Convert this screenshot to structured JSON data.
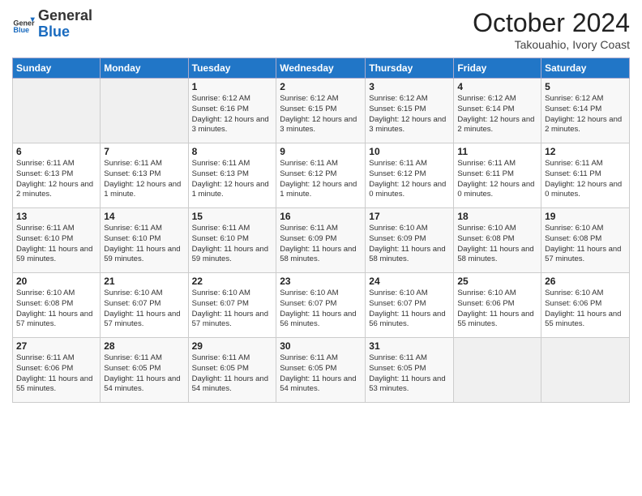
{
  "header": {
    "logo_general": "General",
    "logo_blue": "Blue",
    "month_title": "October 2024",
    "subtitle": "Takouahio, Ivory Coast"
  },
  "days_of_week": [
    "Sunday",
    "Monday",
    "Tuesday",
    "Wednesday",
    "Thursday",
    "Friday",
    "Saturday"
  ],
  "weeks": [
    [
      {
        "day": "",
        "info": ""
      },
      {
        "day": "",
        "info": ""
      },
      {
        "day": "1",
        "info": "Sunrise: 6:12 AM\nSunset: 6:16 PM\nDaylight: 12 hours and 3 minutes."
      },
      {
        "day": "2",
        "info": "Sunrise: 6:12 AM\nSunset: 6:15 PM\nDaylight: 12 hours and 3 minutes."
      },
      {
        "day": "3",
        "info": "Sunrise: 6:12 AM\nSunset: 6:15 PM\nDaylight: 12 hours and 3 minutes."
      },
      {
        "day": "4",
        "info": "Sunrise: 6:12 AM\nSunset: 6:14 PM\nDaylight: 12 hours and 2 minutes."
      },
      {
        "day": "5",
        "info": "Sunrise: 6:12 AM\nSunset: 6:14 PM\nDaylight: 12 hours and 2 minutes."
      }
    ],
    [
      {
        "day": "6",
        "info": "Sunrise: 6:11 AM\nSunset: 6:13 PM\nDaylight: 12 hours and 2 minutes."
      },
      {
        "day": "7",
        "info": "Sunrise: 6:11 AM\nSunset: 6:13 PM\nDaylight: 12 hours and 1 minute."
      },
      {
        "day": "8",
        "info": "Sunrise: 6:11 AM\nSunset: 6:13 PM\nDaylight: 12 hours and 1 minute."
      },
      {
        "day": "9",
        "info": "Sunrise: 6:11 AM\nSunset: 6:12 PM\nDaylight: 12 hours and 1 minute."
      },
      {
        "day": "10",
        "info": "Sunrise: 6:11 AM\nSunset: 6:12 PM\nDaylight: 12 hours and 0 minutes."
      },
      {
        "day": "11",
        "info": "Sunrise: 6:11 AM\nSunset: 6:11 PM\nDaylight: 12 hours and 0 minutes."
      },
      {
        "day": "12",
        "info": "Sunrise: 6:11 AM\nSunset: 6:11 PM\nDaylight: 12 hours and 0 minutes."
      }
    ],
    [
      {
        "day": "13",
        "info": "Sunrise: 6:11 AM\nSunset: 6:10 PM\nDaylight: 11 hours and 59 minutes."
      },
      {
        "day": "14",
        "info": "Sunrise: 6:11 AM\nSunset: 6:10 PM\nDaylight: 11 hours and 59 minutes."
      },
      {
        "day": "15",
        "info": "Sunrise: 6:11 AM\nSunset: 6:10 PM\nDaylight: 11 hours and 59 minutes."
      },
      {
        "day": "16",
        "info": "Sunrise: 6:11 AM\nSunset: 6:09 PM\nDaylight: 11 hours and 58 minutes."
      },
      {
        "day": "17",
        "info": "Sunrise: 6:10 AM\nSunset: 6:09 PM\nDaylight: 11 hours and 58 minutes."
      },
      {
        "day": "18",
        "info": "Sunrise: 6:10 AM\nSunset: 6:08 PM\nDaylight: 11 hours and 58 minutes."
      },
      {
        "day": "19",
        "info": "Sunrise: 6:10 AM\nSunset: 6:08 PM\nDaylight: 11 hours and 57 minutes."
      }
    ],
    [
      {
        "day": "20",
        "info": "Sunrise: 6:10 AM\nSunset: 6:08 PM\nDaylight: 11 hours and 57 minutes."
      },
      {
        "day": "21",
        "info": "Sunrise: 6:10 AM\nSunset: 6:07 PM\nDaylight: 11 hours and 57 minutes."
      },
      {
        "day": "22",
        "info": "Sunrise: 6:10 AM\nSunset: 6:07 PM\nDaylight: 11 hours and 57 minutes."
      },
      {
        "day": "23",
        "info": "Sunrise: 6:10 AM\nSunset: 6:07 PM\nDaylight: 11 hours and 56 minutes."
      },
      {
        "day": "24",
        "info": "Sunrise: 6:10 AM\nSunset: 6:07 PM\nDaylight: 11 hours and 56 minutes."
      },
      {
        "day": "25",
        "info": "Sunrise: 6:10 AM\nSunset: 6:06 PM\nDaylight: 11 hours and 55 minutes."
      },
      {
        "day": "26",
        "info": "Sunrise: 6:10 AM\nSunset: 6:06 PM\nDaylight: 11 hours and 55 minutes."
      }
    ],
    [
      {
        "day": "27",
        "info": "Sunrise: 6:11 AM\nSunset: 6:06 PM\nDaylight: 11 hours and 55 minutes."
      },
      {
        "day": "28",
        "info": "Sunrise: 6:11 AM\nSunset: 6:05 PM\nDaylight: 11 hours and 54 minutes."
      },
      {
        "day": "29",
        "info": "Sunrise: 6:11 AM\nSunset: 6:05 PM\nDaylight: 11 hours and 54 minutes."
      },
      {
        "day": "30",
        "info": "Sunrise: 6:11 AM\nSunset: 6:05 PM\nDaylight: 11 hours and 54 minutes."
      },
      {
        "day": "31",
        "info": "Sunrise: 6:11 AM\nSunset: 6:05 PM\nDaylight: 11 hours and 53 minutes."
      },
      {
        "day": "",
        "info": ""
      },
      {
        "day": "",
        "info": ""
      }
    ]
  ]
}
